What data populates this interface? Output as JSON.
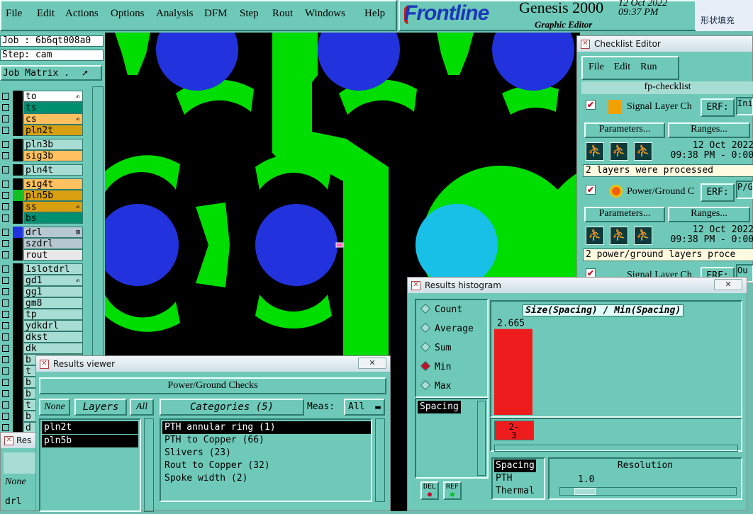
{
  "menubar": {
    "items": [
      "File",
      "Edit",
      "Actions",
      "Options",
      "Analysis",
      "DFM",
      "Step",
      "Rout",
      "Windows",
      "Help"
    ]
  },
  "brand": {
    "logo": "Frontline",
    "product": "Genesis 2000",
    "date": "12 Oct 2022",
    "time": "09:37 PM",
    "editor": "Graphic Editor"
  },
  "taskbar_snippet": "形状填充",
  "job": {
    "job_line": "Job : 6b6qt008a0",
    "step_line": "Step: cam",
    "job_matrix": "Job Matrix ."
  },
  "layers": [
    {
      "name": "to",
      "color": "#ffffff",
      "flag": "✍"
    },
    {
      "name": "ts",
      "color": "#009070",
      "flag": ""
    },
    {
      "name": "cs",
      "color": "#ffc060",
      "flag": "✍"
    },
    {
      "name": "pln2t",
      "color": "#d8a010",
      "flag": ""
    },
    {
      "name": "pln3b",
      "color": "#a8ddd3",
      "flag": ""
    },
    {
      "name": "sig3b",
      "color": "#ffc060",
      "flag": ""
    },
    {
      "name": "pln4t",
      "color": "#a8ddd3",
      "flag": ""
    },
    {
      "name": "sig4t",
      "color": "#ffc060",
      "flag": ""
    },
    {
      "name": "pln5b",
      "color": "#d8a010",
      "flag": ""
    },
    {
      "name": "ss",
      "color": "#d8a010",
      "flag": "✍"
    },
    {
      "name": "bs",
      "color": "#009070",
      "flag": ""
    },
    {
      "name": "drl",
      "color": "#b8c8d0",
      "flag": "⊞"
    },
    {
      "name": "szdrl",
      "color": "#b8c8d0",
      "flag": ""
    },
    {
      "name": "rout",
      "color": "#e8e8e8",
      "flag": ""
    },
    {
      "name": "1slotdrl",
      "color": "#a8ddd3",
      "flag": ""
    },
    {
      "name": "gd1",
      "color": "#a8ddd3",
      "flag": "✍"
    },
    {
      "name": "gg1",
      "color": "#a8ddd3",
      "flag": ""
    },
    {
      "name": "gm8",
      "color": "#a8ddd3",
      "flag": ""
    },
    {
      "name": "tp",
      "color": "#a8ddd3",
      "flag": ""
    },
    {
      "name": "ydkdrl",
      "color": "#a8ddd3",
      "flag": ""
    },
    {
      "name": "dkst",
      "color": "#a8ddd3",
      "flag": ""
    },
    {
      "name": "dk",
      "color": "#a8ddd3",
      "flag": ""
    },
    {
      "name": "b",
      "color": "#a8ddd3",
      "flag": ""
    },
    {
      "name": "t",
      "color": "#a8ddd3",
      "flag": ""
    },
    {
      "name": "b",
      "color": "#a8ddd3",
      "flag": ""
    },
    {
      "name": "b",
      "color": "#a8ddd3",
      "flag": ""
    },
    {
      "name": "t",
      "color": "#a8ddd3",
      "flag": ""
    },
    {
      "name": "b",
      "color": "#a8ddd3",
      "flag": ""
    },
    {
      "name": "d",
      "color": "#a8ddd3",
      "flag": ""
    }
  ],
  "checklist": {
    "title": "Checklist Editor",
    "menu": [
      "File",
      "Edit",
      "Run"
    ],
    "name": "fp-checklist",
    "items": [
      {
        "name": "Signal Layer Ch",
        "erf": "ERF:",
        "erf_val": "Ini",
        "params": "Parameters...",
        "ranges": "Ranges...",
        "date": "12 Oct 2022",
        "time": "09:38 PM - 0:00",
        "status": "2 layers were processed"
      },
      {
        "name": "Power/Ground C",
        "erf": "ERF:",
        "erf_val": "P/G",
        "params": "Parameters...",
        "ranges": "Ranges...",
        "date": "12 Oct 2022",
        "time": "09:38 PM - 0:00",
        "status": "2 power/ground layers proce"
      },
      {
        "name": "Signal Layer Ch",
        "erf": "ERF:",
        "erf_val": "Ou"
      }
    ]
  },
  "results_viewer": {
    "title": "Results viewer",
    "header": "Power/Ground Checks",
    "none": "None",
    "layers_label": "Layers",
    "all": "All",
    "categories_label": "Categories (5)",
    "meas_label": "Meas:",
    "meas_value": "All",
    "layers": [
      "pln2t",
      "pln5b"
    ],
    "categories": [
      "PTH annular ring (1)",
      "PTH to Copper (66)",
      "Slivers (23)",
      "Rout to Copper (32)",
      "Spoke width (2)"
    ]
  },
  "results_peek": {
    "title": "Res",
    "none": "None",
    "layer": "drl"
  },
  "histogram": {
    "title": "Results histogram",
    "radios": [
      "Count",
      "Average",
      "Sum",
      "Min",
      "Max"
    ],
    "selected_radio": "Min",
    "list_selected": "Spacing",
    "del": "DEL",
    "ref": "REF",
    "chart_title": "Size(Spacing) / Min(Spacing)",
    "bar_label": "2.665",
    "bin_label_1": "2-",
    "bin_label_2": "3",
    "types": [
      "Spacing",
      "PTH",
      "Thermal"
    ],
    "resolution_label": "Resolution",
    "resolution_value": "1.0"
  },
  "chart_data": {
    "type": "bar",
    "title": "Size(Spacing) / Min(Spacing)",
    "categories": [
      "2-3"
    ],
    "values": [
      2.665
    ],
    "ylim": [
      0,
      2.9
    ]
  },
  "colors": {
    "bg": "#6fc9b8",
    "copper": "#00dd00",
    "pad": "#2233dd",
    "pad_selected": "#18c0e8",
    "bar": "#ee1c1c"
  }
}
